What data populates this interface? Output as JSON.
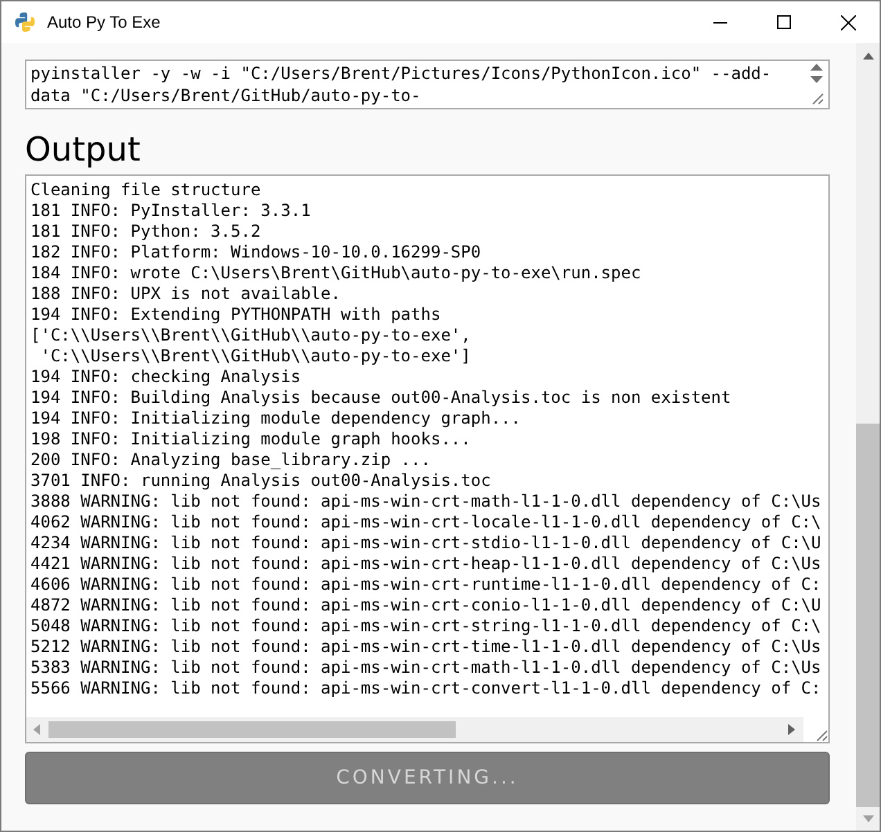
{
  "window": {
    "title": "Auto Py To Exe"
  },
  "command": {
    "value": "pyinstaller -y -w -i \"C:/Users/Brent/Pictures/Icons/PythonIcon.ico\" --add-data \"C:/Users/Brent/GitHub/auto-py-to-"
  },
  "output": {
    "heading": "Output",
    "lines": [
      "Cleaning file structure",
      "181 INFO: PyInstaller: 3.3.1",
      "181 INFO: Python: 3.5.2",
      "182 INFO: Platform: Windows-10-10.0.16299-SP0",
      "184 INFO: wrote C:\\Users\\Brent\\GitHub\\auto-py-to-exe\\run.spec",
      "188 INFO: UPX is not available.",
      "194 INFO: Extending PYTHONPATH with paths",
      "['C:\\\\Users\\\\Brent\\\\GitHub\\\\auto-py-to-exe',",
      " 'C:\\\\Users\\\\Brent\\\\GitHub\\\\auto-py-to-exe']",
      "194 INFO: checking Analysis",
      "194 INFO: Building Analysis because out00-Analysis.toc is non existent",
      "194 INFO: Initializing module dependency graph...",
      "198 INFO: Initializing module graph hooks...",
      "200 INFO: Analyzing base_library.zip ...",
      "3701 INFO: running Analysis out00-Analysis.toc",
      "3888 WARNING: lib not found: api-ms-win-crt-math-l1-1-0.dll dependency of C:\\Us",
      "4062 WARNING: lib not found: api-ms-win-crt-locale-l1-1-0.dll dependency of C:\\",
      "4234 WARNING: lib not found: api-ms-win-crt-stdio-l1-1-0.dll dependency of C:\\U",
      "4421 WARNING: lib not found: api-ms-win-crt-heap-l1-1-0.dll dependency of C:\\Us",
      "4606 WARNING: lib not found: api-ms-win-crt-runtime-l1-1-0.dll dependency of C:",
      "4872 WARNING: lib not found: api-ms-win-crt-conio-l1-1-0.dll dependency of C:\\U",
      "5048 WARNING: lib not found: api-ms-win-crt-string-l1-1-0.dll dependency of C:\\",
      "5212 WARNING: lib not found: api-ms-win-crt-time-l1-1-0.dll dependency of C:\\Us",
      "5383 WARNING: lib not found: api-ms-win-crt-math-l1-1-0.dll dependency of C:\\Us",
      "5566 WARNING: lib not found: api-ms-win-crt-convert-l1-1-0.dll dependency of C:"
    ]
  },
  "convert_button": {
    "label": "CONVERTING...",
    "disabled": true
  }
}
